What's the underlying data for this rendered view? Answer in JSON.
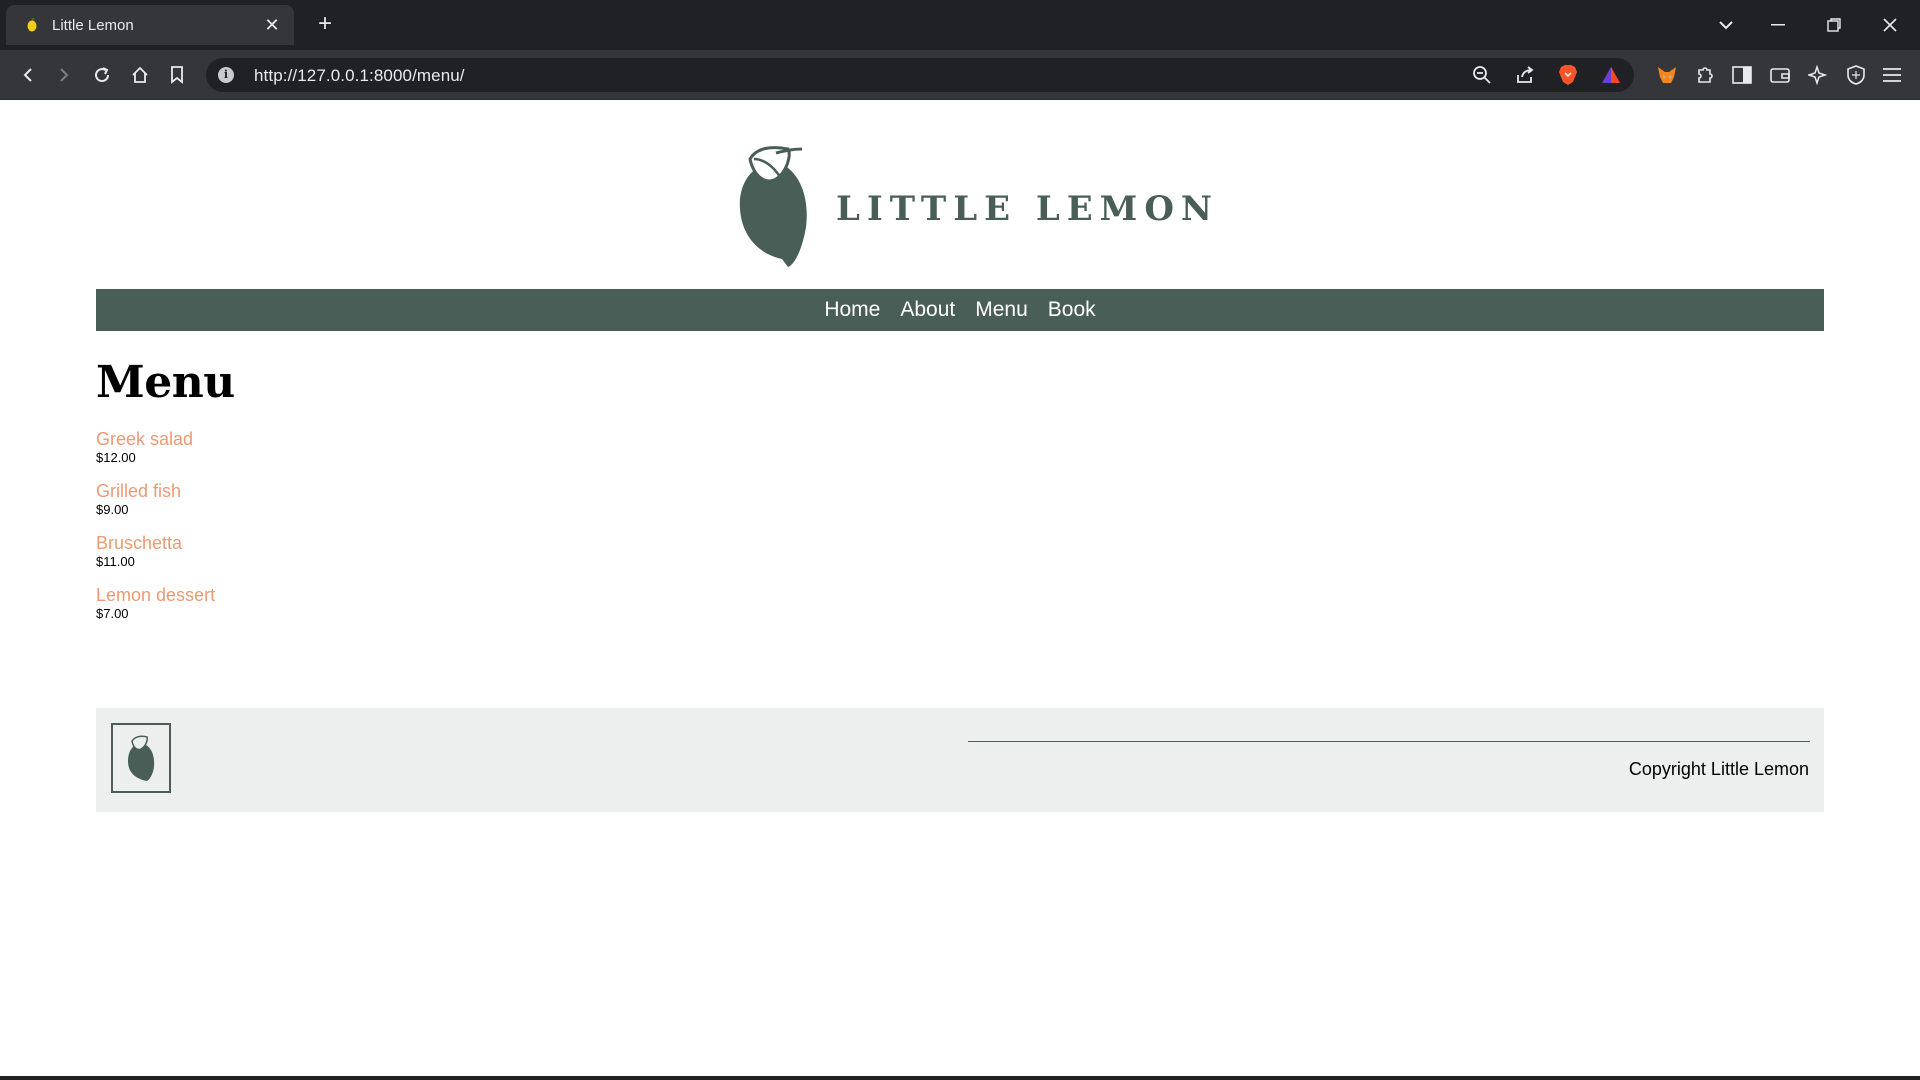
{
  "browser": {
    "tab_title": "Little Lemon",
    "tab_close": "✕",
    "new_tab": "+",
    "url": "http://127.0.0.1:8000/menu/",
    "info_icon_glyph": "i"
  },
  "site": {
    "logo_text": "LITTLE LEMON",
    "brand_color": "#495e57",
    "accent_color": "#ee9972"
  },
  "nav": {
    "items": [
      "Home",
      "About",
      "Menu",
      "Book"
    ]
  },
  "main": {
    "title": "Menu",
    "items": [
      {
        "name": "Greek salad",
        "price": "$12.00"
      },
      {
        "name": "Grilled fish",
        "price": "$9.00"
      },
      {
        "name": "Bruschetta",
        "price": "$11.00"
      },
      {
        "name": "Lemon dessert",
        "price": "$7.00"
      }
    ]
  },
  "footer": {
    "copyright": "Copyright Little Lemon"
  }
}
